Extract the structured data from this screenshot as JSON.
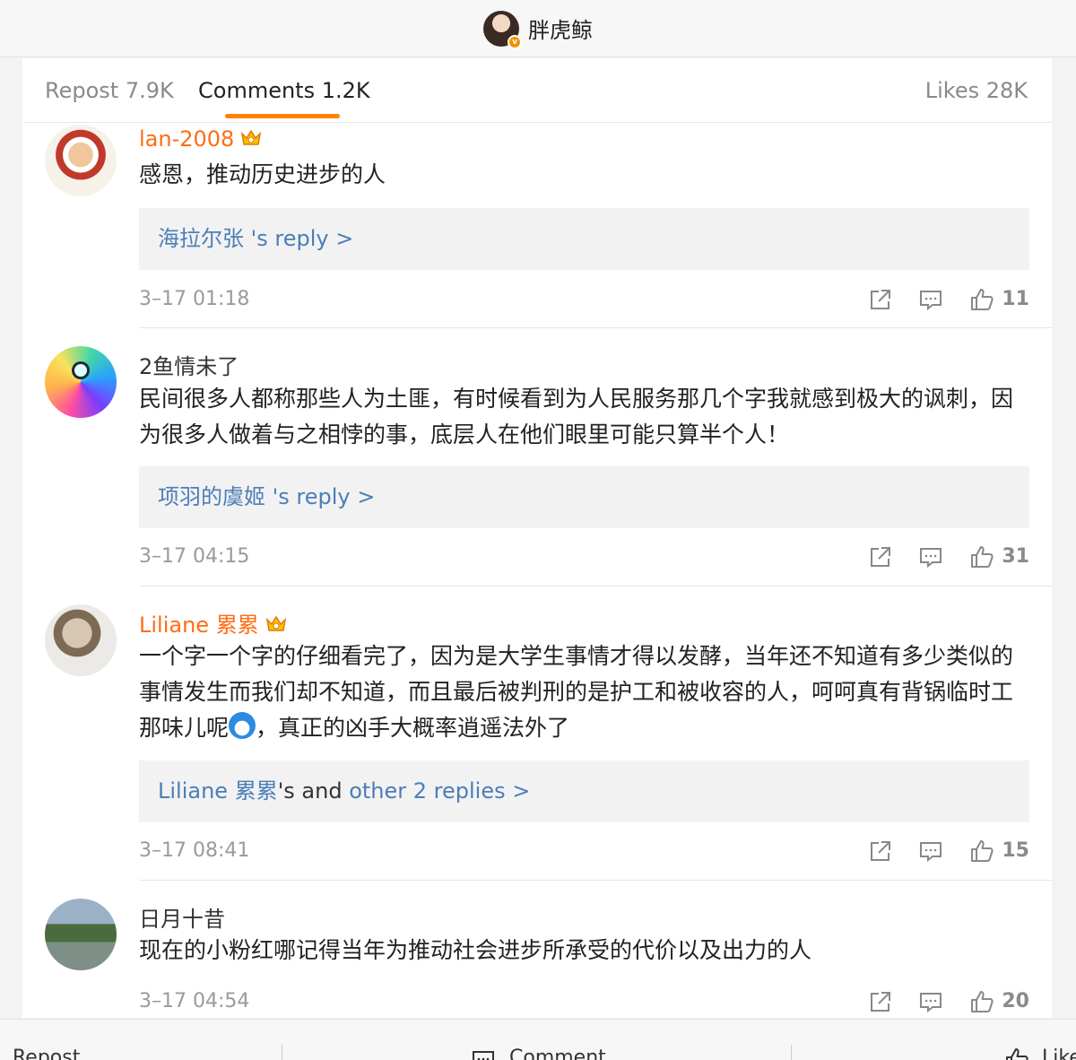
{
  "header": {
    "username": "胖虎鲸",
    "badge": "v"
  },
  "tabs": {
    "repost": "Repost 7.9K",
    "comments": "Comments 1.2K",
    "likes": "Likes 28K"
  },
  "comments": [
    {
      "name": "lan-2008",
      "text": "感恩，推动历史进步的人",
      "reply_name": "海拉尔张",
      "reply_suffix": "  's reply >",
      "time": "3–17 01:18",
      "likes": "11"
    },
    {
      "name": "2鱼情未了",
      "text": "民间很多人都称那些人为土匪，有时候看到为人民服务那几个字我就感到极大的讽刺，因为很多人做着与之相悖的事，底层人在他们眼里可能只算半个人！",
      "reply_name": "项羽的虞姬",
      "reply_suffix": "  's reply >",
      "time": "3–17 04:15",
      "likes": "31"
    },
    {
      "name": "Liliane 累累",
      "text_before": "一个字一个字的仔细看完了，因为是大学生事情才得以发酵，当年还不知道有多少类似的事情发生而我们却不知道，而且最后被判刑的是护工和被收容的人，呵呵真有背锅临时工那味儿呢",
      "text_after": "，真正的凶手大概率逍遥法外了",
      "reply_name": "Liliane 累累",
      "reply_mid": "'s and ",
      "reply_suffix": "other 2 replies >",
      "time": "3–17 08:41",
      "likes": "15"
    },
    {
      "name": "日月十昔",
      "text": "现在的小粉红哪记得当年为推动社会进步所承受的代价以及出力的人",
      "time": "3–17 04:54",
      "likes": "20"
    }
  ],
  "bottom_bar": {
    "repost": "Repost",
    "comment": "Comment",
    "like": "Like"
  }
}
